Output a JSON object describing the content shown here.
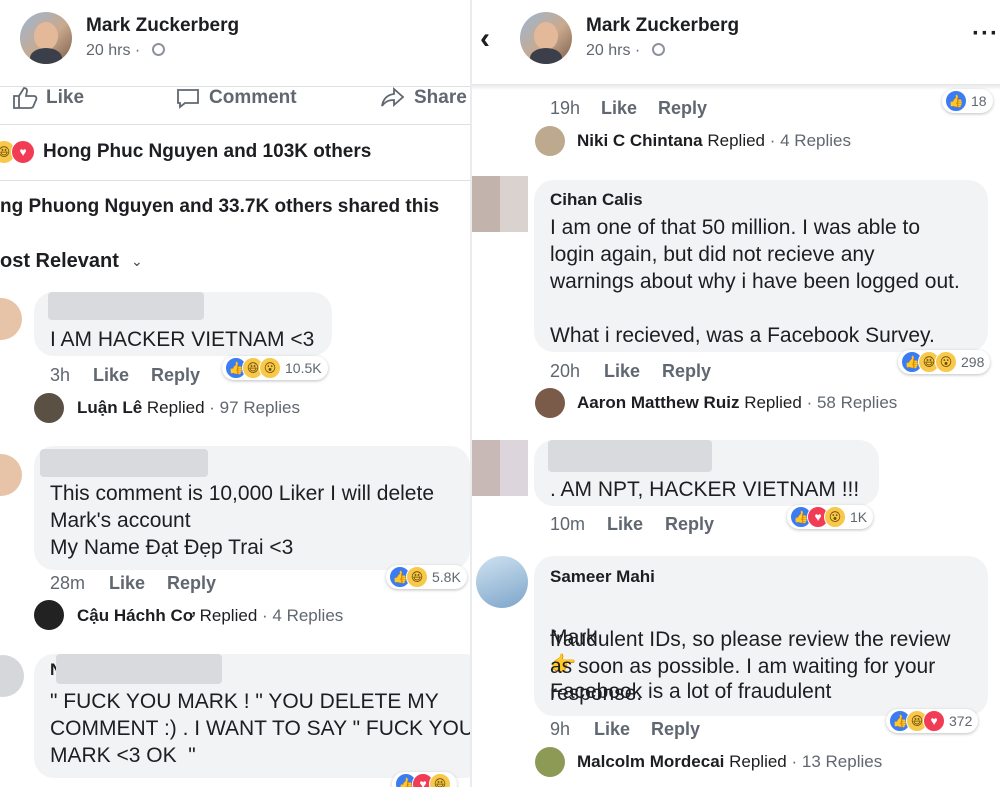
{
  "left": {
    "header": {
      "name": "Mark Zuckerberg",
      "meta": "20 hrs ·",
      "globe_icon": "globe-icon"
    },
    "actions": {
      "like": "Like",
      "comment": "Comment",
      "share": "Share"
    },
    "reactions_summary": "Hong Phuc Nguyen and 103K others",
    "shares_summary": "ng Phuong Nguyen and 33.7K others shared this",
    "sort": "ost Relevant",
    "comments": [
      {
        "text": "I AM HACKER VIETNAM <3",
        "time": "3h",
        "like": "Like",
        "reply": "Reply",
        "reaction_count": "10.5K",
        "replied_by": "Luận Lê",
        "replied_word": "Replied",
        "replies": "· 97 Replies"
      },
      {
        "text": "This comment is 10,000 Liker I will delete\nMark's account\nMy Name Đạt Đẹp Trai <3",
        "time": "28m",
        "like": "Like",
        "reply": "Reply",
        "reaction_count": "5.8K",
        "replied_by": "Cậu Háchh Cơ",
        "replied_word": "Replied",
        "replies": "· 4 Replies"
      },
      {
        "name_fragment": "N",
        "text": "\" FUCK YOU MARK ! \" YOU DELETE MY\nCOMMENT :) . I WANT TO SAY \" FUCK YOU\nMARK <3 OK  \""
      }
    ]
  },
  "right": {
    "header": {
      "name": "Mark Zuckerberg",
      "meta": "20 hrs ·"
    },
    "top_row": {
      "time": "19h",
      "like": "Like",
      "reply": "Reply",
      "reaction_count": "18"
    },
    "top_replied": {
      "name": "Niki C Chintana",
      "word": "Replied",
      "replies": "· 4 Replies"
    },
    "comments": [
      {
        "name": "Cihan Calis",
        "text": "I am one of that 50 million. I was able to\nlogin again, but did not recieve any\nwarnings about why i have been logged out.\n\nWhat i recieved, was a Facebook Survey.",
        "time": "20h",
        "like": "Like",
        "reply": "Reply",
        "reaction_count": "298",
        "replied_by": "Aaron Matthew Ruiz",
        "replied_word": "Replied",
        "replies": "· 58 Replies"
      },
      {
        "text": ". AM NPT, HACKER VIETNAM !!!",
        "time": "10m",
        "like": "Like",
        "reply": "Reply",
        "reaction_count": "1K"
      },
      {
        "name": "Sameer Mahi",
        "text_first": "Mark",
        "text_rest": "Facebook is a lot of fraudulent",
        "text": "fraudulent IDs, so please review the review\nas soon as possible. I am waiting for your\nresponse.",
        "time": "9h",
        "like": "Like",
        "reply": "Reply",
        "reaction_count": "372",
        "replied_by": "Malcolm Mordecai",
        "replied_word": "Replied",
        "replies": "· 13 Replies"
      }
    ]
  },
  "colors": {
    "like_blue": "#3b7cf5",
    "love_red": "#f23b54",
    "haha_yellow": "#f7c84a",
    "bubble_gray": "#f2f3f5",
    "text_gray": "#606770"
  }
}
